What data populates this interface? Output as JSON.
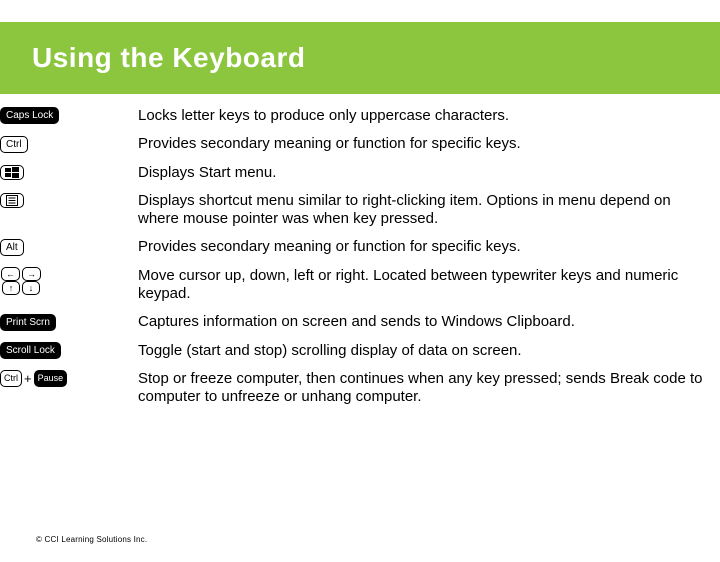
{
  "page_title": "Using the Keyboard",
  "footer": "© CCI Learning Solutions Inc.",
  "rows": [
    {
      "label": "Caps Lock",
      "desc": "Locks letter keys to produce only uppercase characters."
    },
    {
      "label": "Ctrl",
      "desc": "Provides secondary meaning or function for specific keys."
    },
    {
      "label": "windows-key",
      "desc": "Displays Start menu."
    },
    {
      "label": "menu-key",
      "desc": "Displays shortcut menu similar to right-clicking item. Options in menu depend on where mouse pointer was when key pressed."
    },
    {
      "label": "Alt",
      "desc": "Provides secondary meaning or function for specific keys."
    },
    {
      "arrows": [
        "←",
        "→",
        "↑",
        "↓"
      ],
      "desc": "Move cursor up, down, left or right. Located  between typewriter keys and numeric keypad."
    },
    {
      "label": "Print Scrn",
      "desc": "Captures information on screen and sends to Windows Clipboard."
    },
    {
      "label": "Scroll Lock",
      "desc": "Toggle (start and stop) scrolling display of data on screen."
    },
    {
      "combo": [
        "Ctrl",
        "Pause"
      ],
      "plus": "+",
      "desc": "Stop or freeze computer, then continues when any key pressed; sends Break code to computer to unfreeze or unhang computer."
    }
  ]
}
